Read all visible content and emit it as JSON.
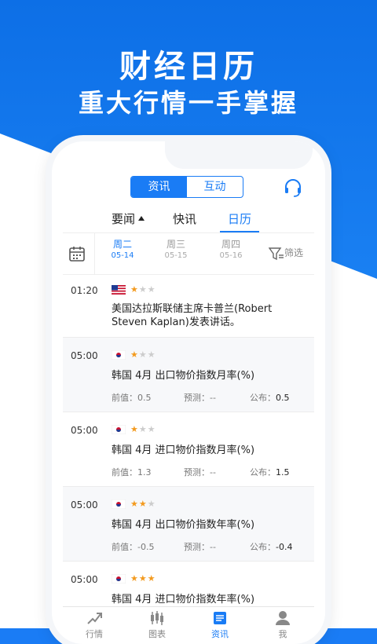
{
  "hero": {
    "title": "财经日历",
    "subtitle": "重大行情一手掌握"
  },
  "segment": {
    "left": "资讯",
    "right": "互动"
  },
  "tabs": {
    "a": "要闻",
    "b": "快讯",
    "c": "日历"
  },
  "dates": {
    "d1": {
      "week": "周二",
      "date": "05-14"
    },
    "d2": {
      "week": "周三",
      "date": "05-15"
    },
    "d3": {
      "week": "周四",
      "date": "05-16"
    },
    "filter": "筛选"
  },
  "events": [
    {
      "time": "01:20",
      "title": "美国达拉斯联储主席卡普兰(Robert Steven Kaplan)发表讲话。"
    },
    {
      "time": "05:00",
      "title": "韩国 4月 出口物价指数月率(%)",
      "prev_label": "前值：",
      "prev": "0.5",
      "fc_label": "预测：",
      "fc": "--",
      "act_label": "公布：",
      "act": "0.5"
    },
    {
      "time": "05:00",
      "title": "韩国 4月 进口物价指数月率(%)",
      "prev_label": "前值：",
      "prev": "1.3",
      "fc_label": "预测：",
      "fc": "--",
      "act_label": "公布：",
      "act": "1.5"
    },
    {
      "time": "05:00",
      "title": "韩国 4月 出口物价指数年率(%)",
      "prev_label": "前值：",
      "prev": "-0.5",
      "fc_label": "预测：",
      "fc": "--",
      "act_label": "公布：",
      "act": "-0.4"
    },
    {
      "time": "05:00",
      "title": "韩国 4月 进口物价指数年率(%)"
    }
  ],
  "nav": {
    "a": "行情",
    "b": "图表",
    "c": "资讯",
    "d": "我"
  },
  "colors": {
    "accent": "#1a7cf5",
    "star": "#f39a1e"
  }
}
